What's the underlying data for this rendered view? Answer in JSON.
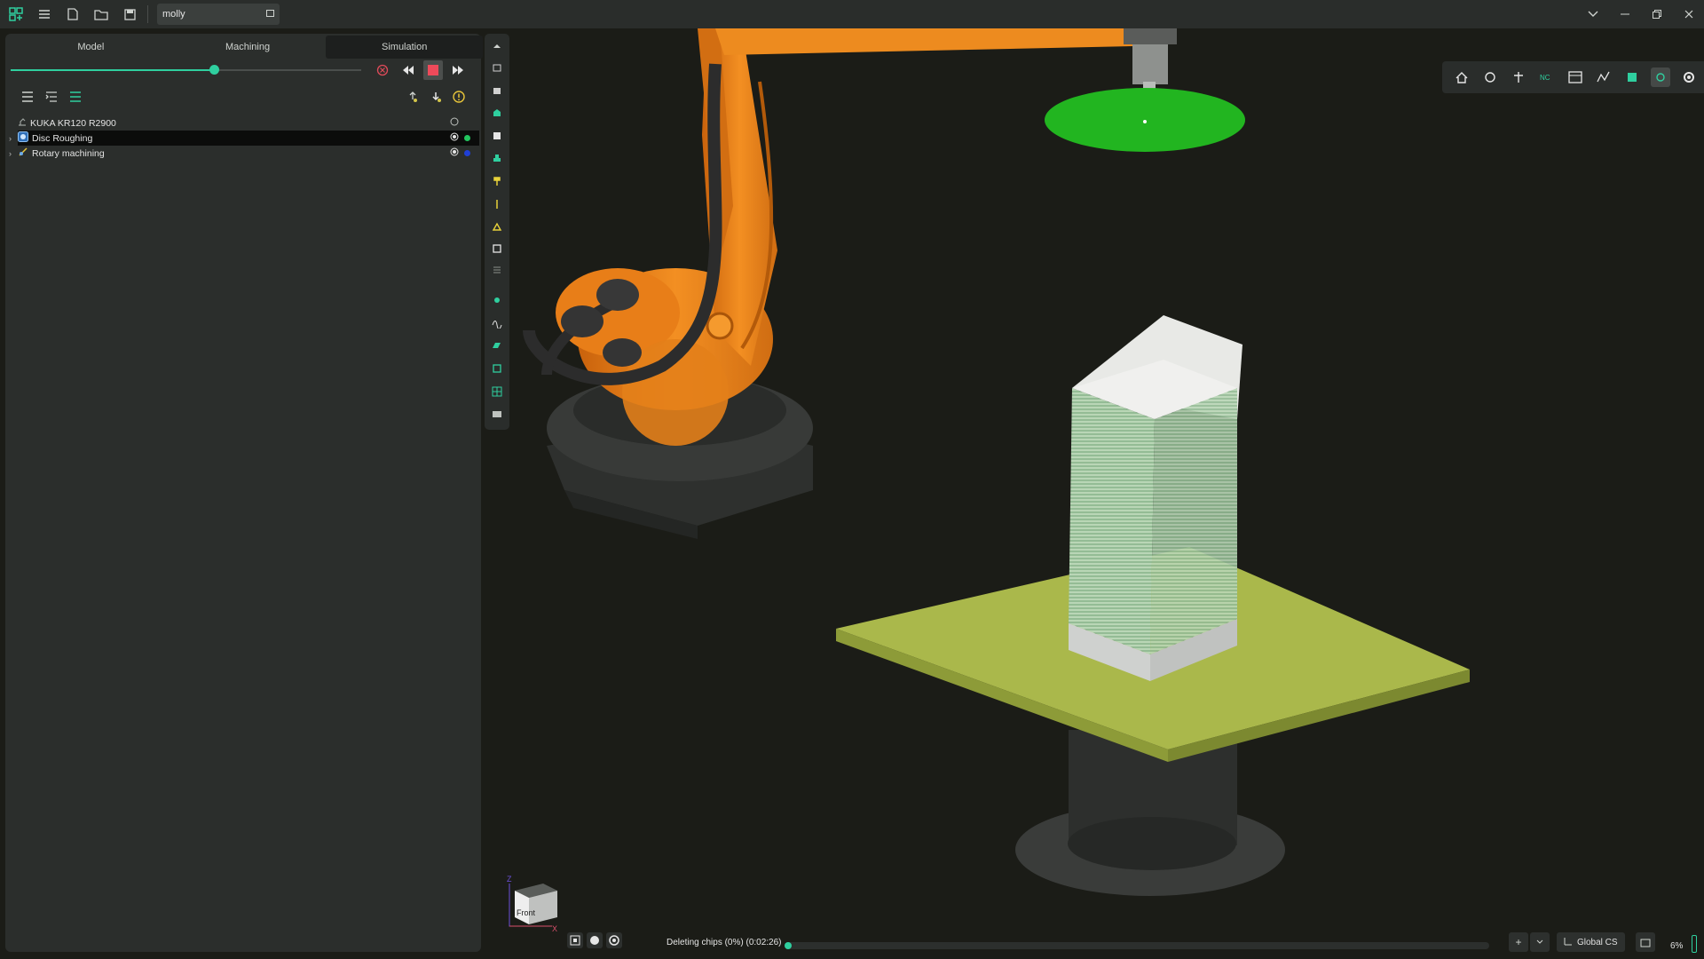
{
  "app": {
    "project_name": "molly"
  },
  "panel": {
    "tabs": [
      {
        "label": "Model"
      },
      {
        "label": "Machining"
      },
      {
        "label": "Simulation"
      }
    ],
    "simulation_progress": 0.58
  },
  "tree": {
    "items": [
      {
        "label": "KUKA KR120 R2900",
        "icon": "robot-icon",
        "selected": false
      },
      {
        "label": "Disc Roughing",
        "icon": "operation-icon",
        "selected": true,
        "status_color": "#22c55e"
      },
      {
        "label": "Rotary machining",
        "icon": "rotary-icon",
        "selected": false,
        "status_color": "#1f3fd6"
      }
    ]
  },
  "navcube": {
    "face_label": "Front",
    "axis_z": "Z",
    "axis_x": "X"
  },
  "status": {
    "message": "Deleting chips (0%) (0:02:26)",
    "progress_percent": 0,
    "coordinate_system": "Global CS",
    "zoom": "6%"
  },
  "colors": {
    "accent": "#2fcf9f",
    "robot": "#f0881c",
    "table": "#a9b84a",
    "tool_disc": "#22b520"
  }
}
